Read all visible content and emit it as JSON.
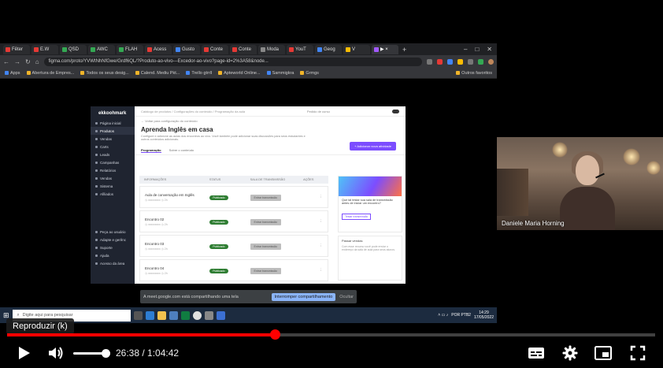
{
  "player": {
    "tooltip": "Reproduzir (k)",
    "time_current": "26:38",
    "time_total": "1:04:42",
    "time_separator": " / ",
    "progress_played": 0.413,
    "progress_loaded": 0.414,
    "volume_level": 1.0,
    "controls": {
      "play_icon": "play-icon",
      "volume_icon": "volume-icon",
      "subtitles_icon": "subtitles-icon",
      "settings_icon": "settings-icon",
      "miniplayer_icon": "miniplayer-icon",
      "fullscreen_icon": "fullscreen-icon"
    },
    "accent_color": "#ff0000"
  },
  "shared_screen": {
    "browser": {
      "tabs": [
        "Fêter",
        "E.W",
        "QSD",
        "AWC",
        "FLAH",
        "Acess",
        "Gusto",
        "Conte",
        "Conte",
        "Moda",
        "YouT",
        "Geog",
        "V",
        "▶ ×"
      ],
      "url": "figma.com/proto/YVWtNhNfGwe/Grdf6QL/?Produto-ao-vivo---Excedor-ao-vivo?page-id=2%3A58&node...",
      "bookmarks": [
        "Apps",
        "Abertura de Empres...",
        "Todos os seus desig...",
        "Calend. Mediu Pkt...",
        "Trello gtrrll",
        "Apteworld Online...",
        "Sammigkra",
        "Grmgs"
      ],
      "bookmarks_right": "Outros favoritos"
    },
    "figma": {
      "logo": "ekkoohmark",
      "sidebar": [
        "Página inicial",
        "Produtos",
        "Vendas",
        "Carts",
        "Leads",
        "Campanhas",
        "Relatórios",
        "Vendas",
        "Sistema",
        "Afiliados"
      ],
      "sidebar_bottom": [
        "Peça ao usuário",
        "Adapte e gerênc",
        "Suporte",
        "Ajuda",
        "Acesso da área"
      ],
      "breadcrumb": "Catálogo de produtos  /  Configurações do conteúdo  /  Programação da aula",
      "top_right": "Pedido de curso",
      "back": "← Voltar para configuração do conteúdo",
      "heading": "Aprenda Inglês em casa",
      "subheading": "Configure e adicione as aulas dos encontros ao vivo. Você também pode adicionar suas discussões para seus estudantes e outros conteúdos adicionais.",
      "primary_button": "+ Adicionar nova atividade",
      "tabs": [
        "Programação",
        "Sobre o conteúdo"
      ],
      "table_headers": [
        "INFORMAÇÕES",
        "STATUS",
        "SALA DE TRANSMISSÃO",
        "AÇÕES"
      ],
      "rows": [
        {
          "title": "Aula de conversação em Inglês",
          "meta": "◷ xxxxxxxxx  ◷ 2h",
          "status": "Publicado",
          "action": "Entrar transmissão"
        },
        {
          "title": "Encontro 02",
          "meta": "◷ xxxxxxxxx  ◷ 2h",
          "status": "Publicado",
          "action": "Entrar transmissão"
        },
        {
          "title": "Encontro 03",
          "meta": "◷ xxxxxxxxx  ◷ 2h",
          "status": "Publicado",
          "action": "Entrar transmissão"
        },
        {
          "title": "Encontro 04",
          "meta": "◷ xxxxxxxxx  ◷ 2h",
          "status": "Publicado",
          "action": "Entrar transmissão"
        }
      ],
      "side_card": {
        "text": "Que tal testar sua sala de transmissão antes de iniciar um encontro?",
        "button": "Testar transmissão"
      },
      "side_card2": {
        "title": "Passar vendas",
        "text": "Com esse recurso você pode enviar o endereço da sala de aula para seus alunos."
      }
    },
    "share_bar": {
      "message": "A meet.google.com está compartilhando uma tela",
      "stop": "Interromper compartilhamento",
      "hide": "Ocultar"
    },
    "taskbar": {
      "search_placeholder": "Digite aqui para pesquisar",
      "lang": "POR PTB2",
      "time": "14:29",
      "date": "17/05/2022"
    }
  },
  "webcam": {
    "name": "Daniele Maria Horning"
  }
}
